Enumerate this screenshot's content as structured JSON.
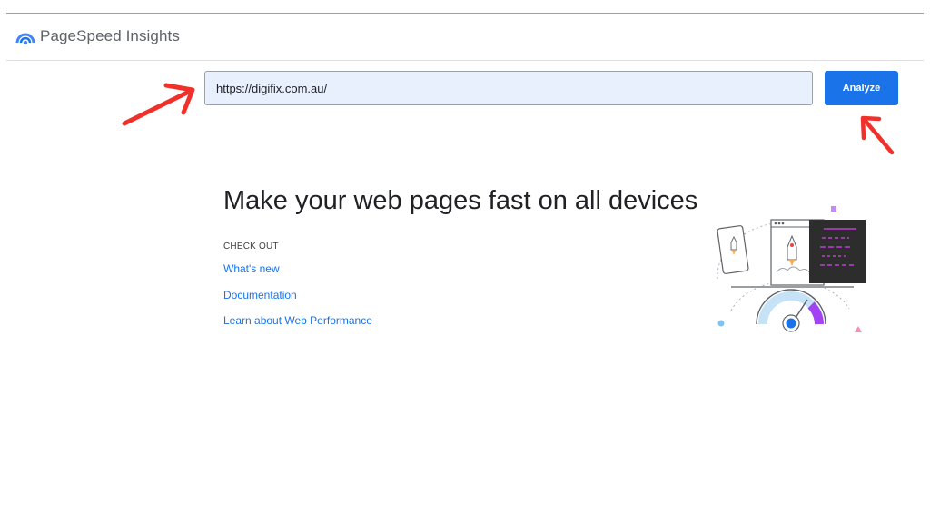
{
  "header": {
    "app_title": "PageSpeed Insights",
    "logo_icon": "pagespeed-gauge-icon"
  },
  "search": {
    "url_value": "https://digifix.com.au/",
    "analyze_label": "Analyze"
  },
  "main": {
    "heading": "Make your web pages fast on all devices",
    "check_out_label": "CHECK OUT",
    "links": [
      "What's new",
      "Documentation",
      "Learn about Web Performance"
    ]
  },
  "colors": {
    "accent": "#1a73e8",
    "input_background": "#e8f0fe",
    "annotation_arrow": "#f0302b"
  },
  "icons": {
    "illustration": "devices-speed-illustration",
    "annotation": "red-arrow-icon"
  }
}
